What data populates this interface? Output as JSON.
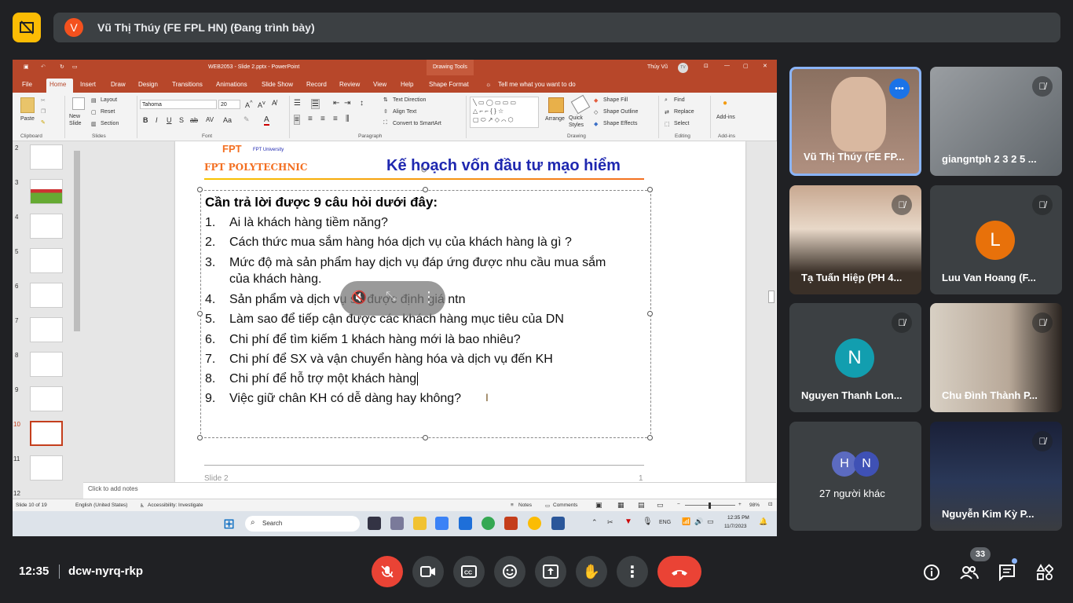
{
  "meet": {
    "presenter_initial": "V",
    "presenter_label": "Vũ Thị Thúy (FE FPL HN) (Đang trình bày)",
    "time": "12:35",
    "meeting_code": "dcw-nyrq-rkp",
    "participant_count": "33",
    "accent_colors": {
      "stop_present": "#fbbc04",
      "end_call": "#ea4335",
      "mic_off": "#ea4335"
    },
    "tiles": [
      {
        "name": "Vũ Thị Thúy (FE FP...",
        "speaking": true
      },
      {
        "name": "giangntph 2 3 2 5 ..."
      },
      {
        "name": "Tạ Tuấn Hiệp (PH 4..."
      },
      {
        "name": "Luu Van Hoang (F...",
        "initial": "L",
        "color": "#e8710a"
      },
      {
        "name": "Nguyen Thanh Lon...",
        "initial": "N",
        "color": "#129eaf"
      },
      {
        "name": "Chu Đình Thành P..."
      },
      {
        "name": "27 người khác",
        "initials": [
          "H",
          "N"
        ]
      },
      {
        "name": "Nguyễn Kim Kỳ P..."
      }
    ]
  },
  "pp": {
    "window_title": "WEB2053 - Slide 2.pptx - PowerPoint",
    "drawing_tools": "Drawing Tools",
    "user": "Thúy Vũ",
    "user_initials": "TV",
    "tabs": [
      "File",
      "Home",
      "Insert",
      "Draw",
      "Design",
      "Transitions",
      "Animations",
      "Slide Show",
      "Record",
      "Review",
      "View",
      "Help",
      "Shape Format"
    ],
    "tell_me": "Tell me what you want to do",
    "ribbon": {
      "paste": "Paste",
      "new_slide": "New Slide",
      "layout": "Layout",
      "reset": "Reset",
      "section": "Section",
      "font_name": "Tahoma",
      "font_size": "20",
      "text_direction": "Text Direction",
      "align_text": "Align Text",
      "convert_smartart": "Convert to SmartArt",
      "arrange": "Arrange",
      "quick_styles": "Quick Styles",
      "shape_fill": "Shape Fill",
      "shape_outline": "Shape Outline",
      "shape_effects": "Shape Effects",
      "find": "Find",
      "replace": "Replace",
      "select": "Select",
      "addins": "Add-ins",
      "groups": [
        "Clipboard",
        "Slides",
        "Font",
        "Paragraph",
        "Drawing",
        "Editing",
        "Add-ins"
      ]
    },
    "slide_numbers": [
      "2",
      "3",
      "4",
      "5",
      "6",
      "7",
      "8",
      "9",
      "10",
      "11",
      "12"
    ],
    "selected_slide": "10",
    "slide": {
      "logo_text": "FPT University",
      "brand": "FPT POLYTECHNIC",
      "title": "Kế hoạch vốn đầu tư mạo hiểm",
      "heading": "Cần trả lời được 9 câu hỏi dưới đây:",
      "questions": [
        {
          "n": "1.",
          "t": "Ai là khách hàng tiềm năng?"
        },
        {
          "n": "2.",
          "t": "Cách thức mua sắm hàng hóa dịch vụ của khách hàng là gì ?"
        },
        {
          "n": "3.",
          "t": "Mức độ mà sản phẩm hay dịch vụ đáp ứng được nhu cầu mua sắm",
          "t2": "của khách hàng."
        },
        {
          "n": "4.",
          "t": "Sản phẩm và dịch vụ sẽ được định giá ntn"
        },
        {
          "n": "5.",
          "t": "Làm sao để tiếp cận được các khách hàng mục tiêu của DN"
        },
        {
          "n": "6.",
          "t": "Chi phí để tìm kiếm 1 khách hàng mới là bao nhiêu?"
        },
        {
          "n": "7.",
          "t": "Chi phí để SX và vận chuyển hàng hóa và dịch vụ đến KH"
        },
        {
          "n": "8.",
          "t": "Chi phí để hỗ trợ một khách hàng"
        },
        {
          "n": "9.",
          "t": "Việc giữ chân KH có dễ dàng hay không?"
        }
      ],
      "footer": "Slide 2",
      "page_num": "1"
    },
    "notes_placeholder": "Click to add notes",
    "status": {
      "slide_of": "Slide 10 of 19",
      "language": "English (United States)",
      "accessibility": "Accessibility: Investigate",
      "notes": "Notes",
      "comments": "Comments",
      "zoom": "98%"
    },
    "taskbar": {
      "search": "Search",
      "lang": "ENG",
      "time": "12:35 PM",
      "date": "11/7/2023"
    }
  }
}
